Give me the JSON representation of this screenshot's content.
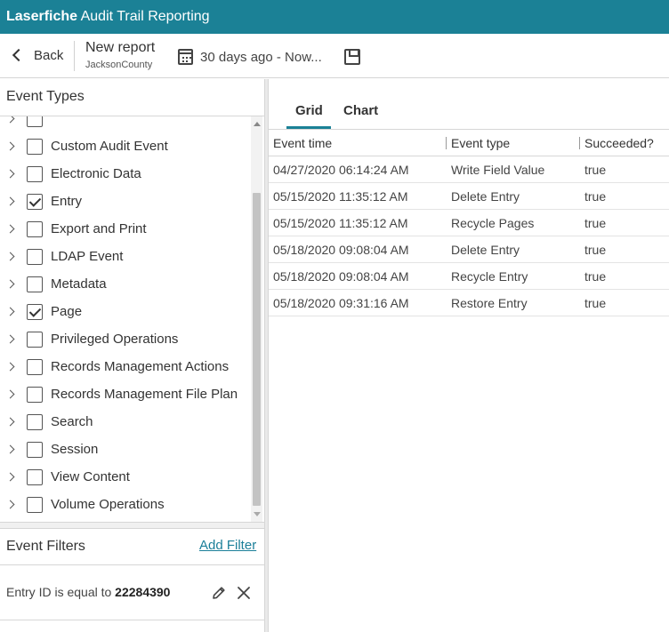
{
  "app": {
    "brand": "Laserfiche",
    "title": "Audit Trail Reporting",
    "accent": "#1b8196"
  },
  "toolbar": {
    "back_label": "Back",
    "report_title": "New report",
    "repository": "JacksonCounty",
    "date_range": "30 days ago - Now..."
  },
  "event_types": {
    "title": "Event Types",
    "items": [
      {
        "label": "Custom Audit Event",
        "checked": false
      },
      {
        "label": "Electronic Data",
        "checked": false
      },
      {
        "label": "Entry",
        "checked": true
      },
      {
        "label": "Export and Print",
        "checked": false
      },
      {
        "label": "LDAP Event",
        "checked": false
      },
      {
        "label": "Metadata",
        "checked": false
      },
      {
        "label": "Page",
        "checked": true
      },
      {
        "label": "Privileged Operations",
        "checked": false
      },
      {
        "label": "Records Management Actions",
        "checked": false
      },
      {
        "label": "Records Management File Plan",
        "checked": false
      },
      {
        "label": "Search",
        "checked": false
      },
      {
        "label": "Session",
        "checked": false
      },
      {
        "label": "View Content",
        "checked": false
      },
      {
        "label": "Volume Operations",
        "checked": false
      }
    ]
  },
  "event_filters": {
    "title": "Event Filters",
    "add_label": "Add Filter",
    "items": [
      {
        "text": "Entry ID is equal to",
        "value": "22284390"
      }
    ]
  },
  "tabs": [
    {
      "label": "Grid",
      "active": true
    },
    {
      "label": "Chart",
      "active": false
    }
  ],
  "grid": {
    "columns": [
      "Event time",
      "Event type",
      "Succeeded?"
    ],
    "rows": [
      [
        "04/27/2020 06:14:24 AM",
        "Write Field Value",
        "true"
      ],
      [
        "05/15/2020 11:35:12 AM",
        "Delete Entry",
        "true"
      ],
      [
        "05/15/2020 11:35:12 AM",
        "Recycle Pages",
        "true"
      ],
      [
        "05/18/2020 09:08:04 AM",
        "Delete Entry",
        "true"
      ],
      [
        "05/18/2020 09:08:04 AM",
        "Recycle Entry",
        "true"
      ],
      [
        "05/18/2020 09:31:16 AM",
        "Restore Entry",
        "true"
      ]
    ]
  }
}
